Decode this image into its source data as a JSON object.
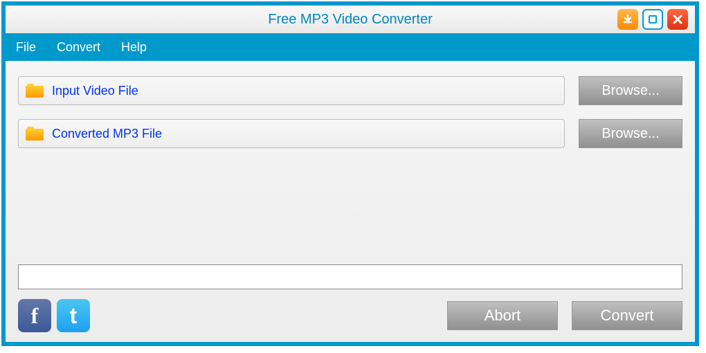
{
  "titlebar": {
    "title": "Free MP3 Video Converter"
  },
  "menubar": {
    "file": "File",
    "convert": "Convert",
    "help": "Help"
  },
  "fields": {
    "input": {
      "label": "Input Video File",
      "browse": "Browse..."
    },
    "output": {
      "label": "Converted MP3 File",
      "browse": "Browse..."
    }
  },
  "social": {
    "fb": "f",
    "tw": "t"
  },
  "buttons": {
    "abort": "Abort",
    "convert": "Convert"
  }
}
